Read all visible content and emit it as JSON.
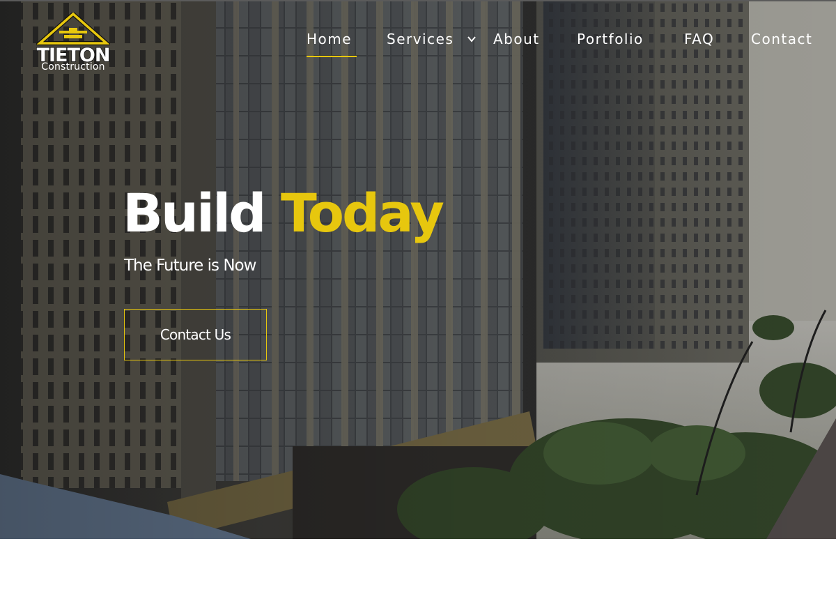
{
  "brand": {
    "name": "TIETON",
    "sub": "Construction",
    "colors": {
      "accent": "#e7c70e",
      "text": "#ffffff"
    }
  },
  "nav": {
    "items": [
      {
        "label": "Home",
        "active": true
      },
      {
        "label": "Services",
        "has_dropdown": true
      },
      {
        "label": "About"
      },
      {
        "label": "Portfolio"
      },
      {
        "label": "FAQ"
      },
      {
        "label": "Contact"
      }
    ],
    "dropdown_icon": "chevron-down-icon"
  },
  "hero": {
    "headline_white": "Build",
    "headline_yellow": "Today",
    "subheadline": "The Future is Now",
    "cta_label": "Contact Us",
    "background": "city-buildings-photo"
  }
}
